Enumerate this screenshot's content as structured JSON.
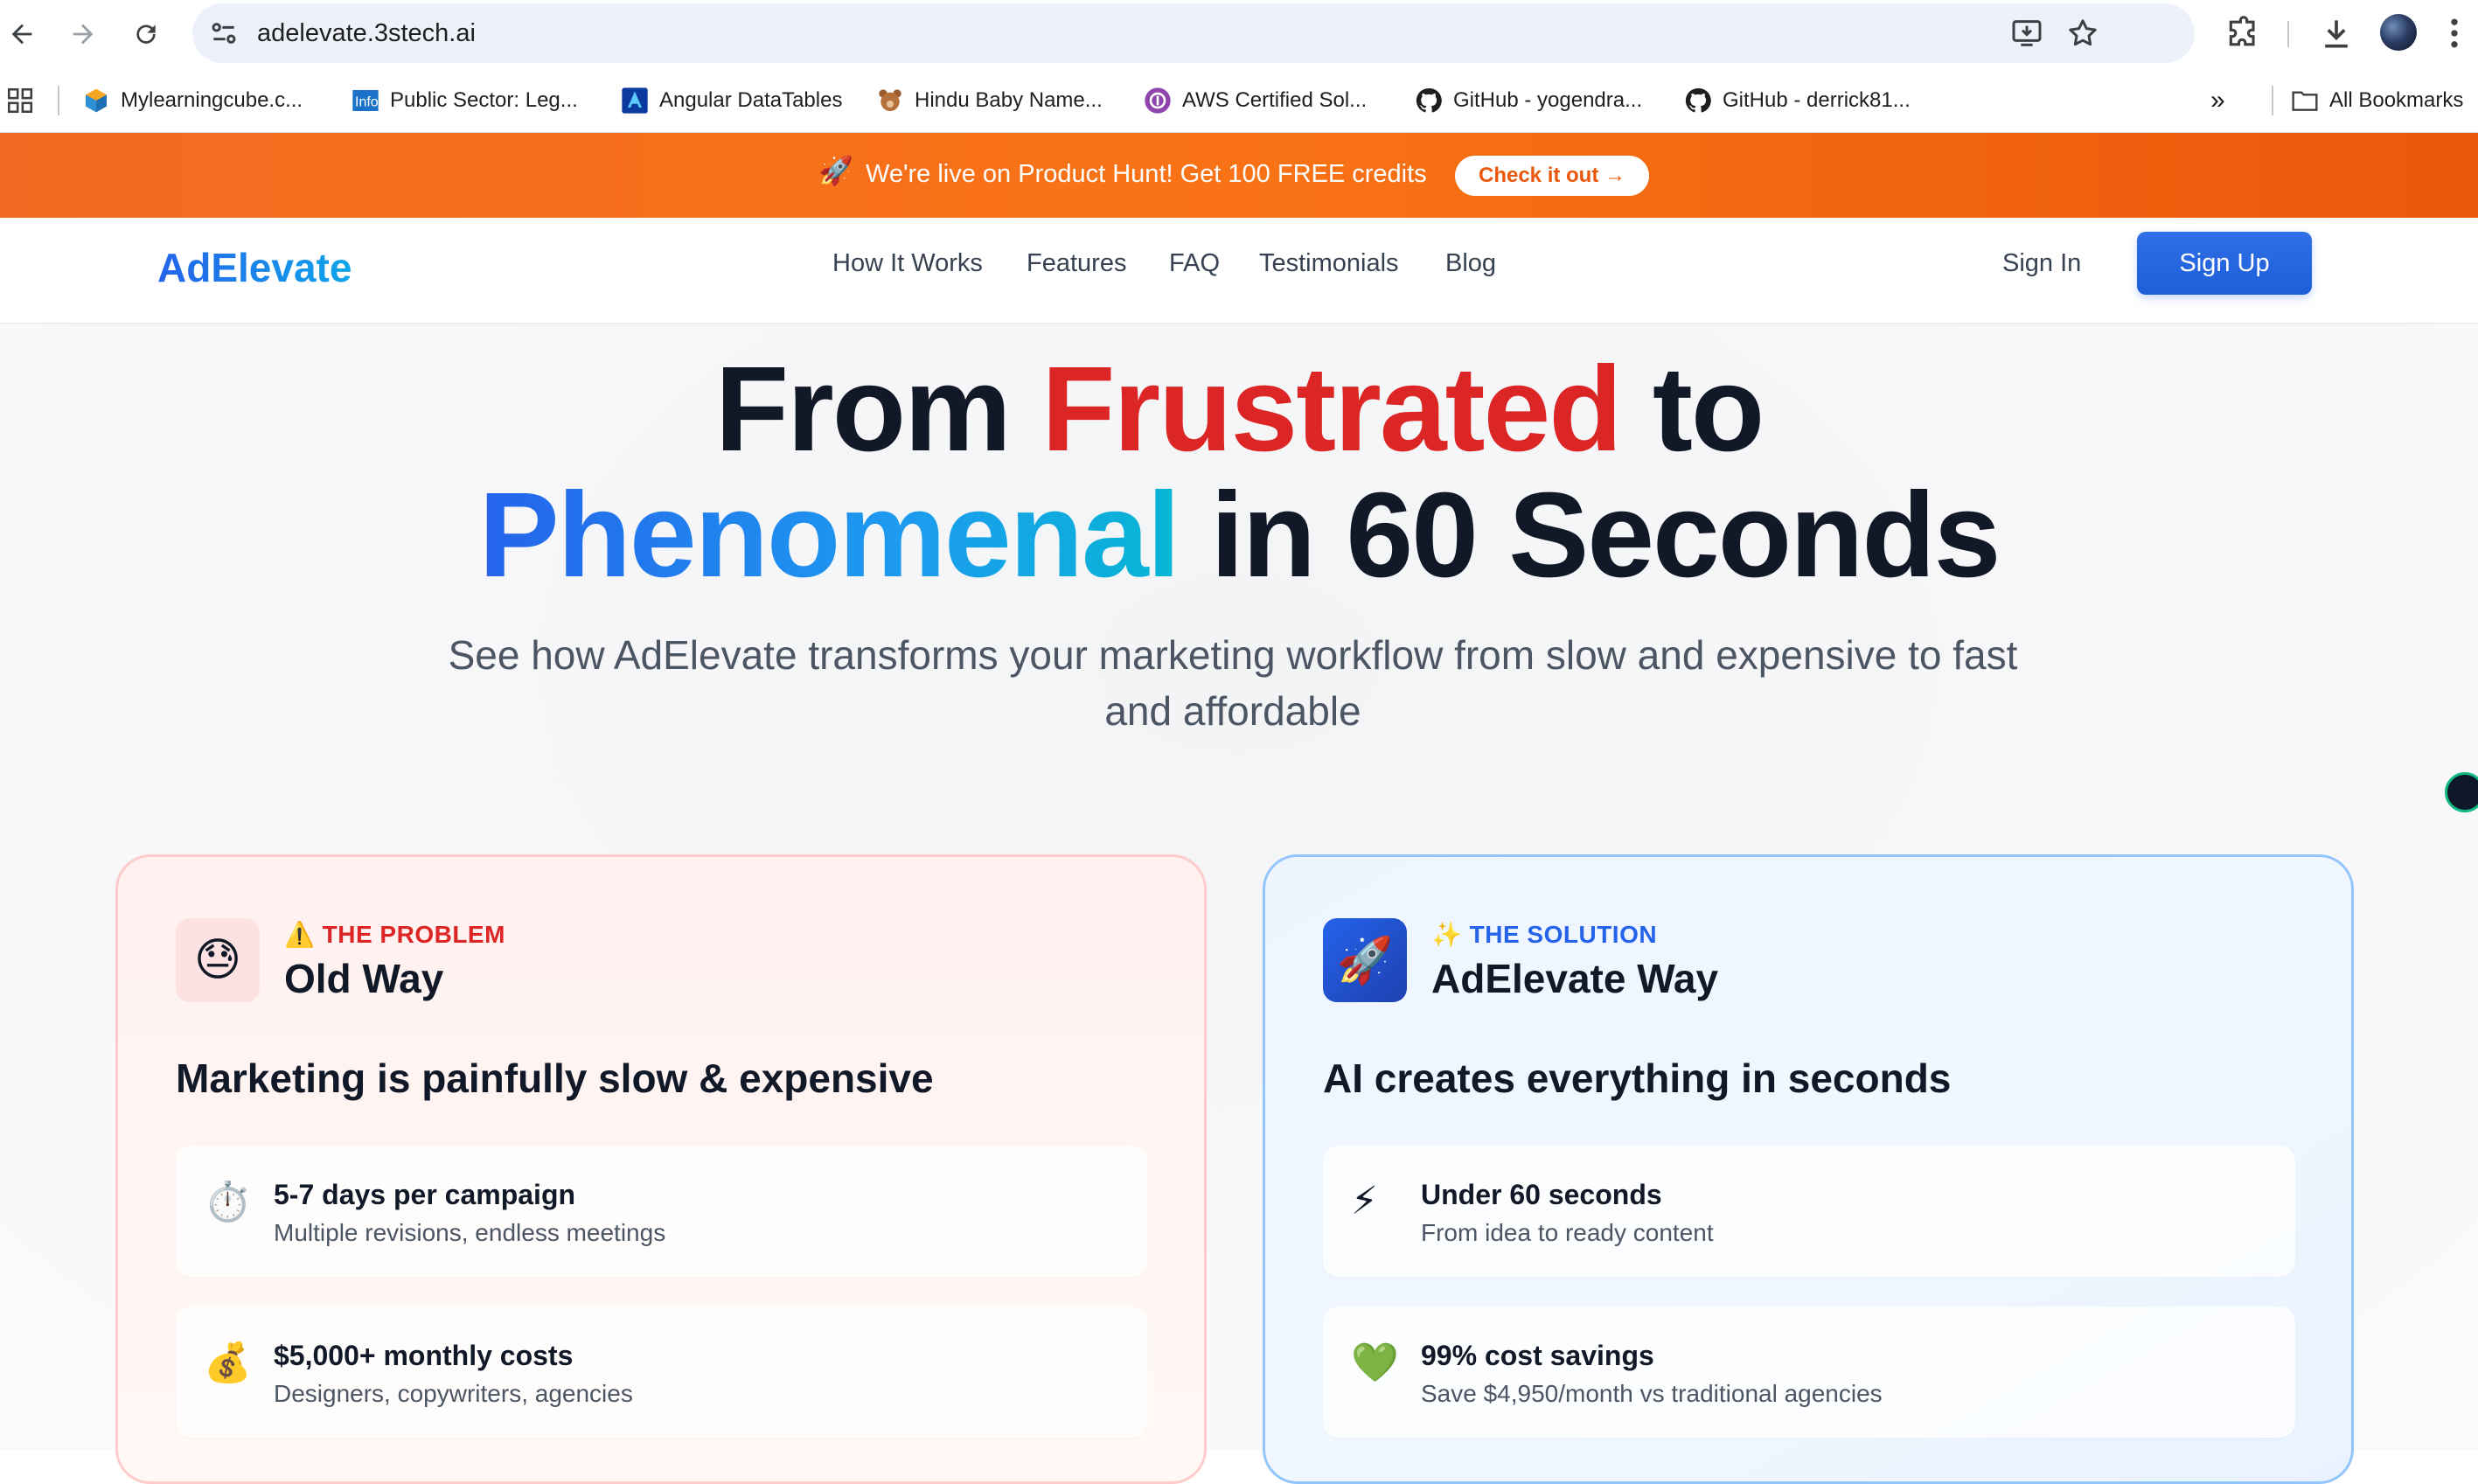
{
  "browser": {
    "url": "adelevate.3stech.ai",
    "bookmarks": [
      {
        "label": "Mylearningcube.c...",
        "icon": "cube-icon"
      },
      {
        "label": "Public Sector: Leg...",
        "icon": "info-icon"
      },
      {
        "label": "Angular DataTables",
        "icon": "angular-icon"
      },
      {
        "label": "Hindu Baby Name...",
        "icon": "teddy-icon"
      },
      {
        "label": "AWS Certified Sol...",
        "icon": "aws-icon"
      },
      {
        "label": "GitHub - yogendra...",
        "icon": "github-icon"
      },
      {
        "label": "GitHub - derrick81...",
        "icon": "github-icon"
      }
    ],
    "more_label": "»",
    "all_bookmarks_label": "All Bookmarks"
  },
  "banner": {
    "emoji": "🚀",
    "text": "We're live on Product Hunt!  Get 100 FREE credits",
    "cta": "Check it out →"
  },
  "nav": {
    "logo": "AdElevate",
    "links": [
      "How It Works",
      "Features",
      "FAQ",
      "Testimonials",
      "Blog"
    ],
    "sign_in": "Sign In",
    "sign_up": "Sign Up"
  },
  "hero": {
    "line1_a": "From ",
    "line1_b": "Frustrated",
    "line1_c": " to",
    "line2_a": "Phenomenal",
    "line2_b": " in 60 Seconds",
    "subtitle": "See how AdElevate transforms your marketing workflow from slow and expensive to fast and affordable"
  },
  "problem": {
    "icon": "😓",
    "tag": "⚠️ THE PROBLEM",
    "title": "Old Way",
    "heading": "Marketing is painfully slow & expensive",
    "items": [
      {
        "emoji": "⏱️",
        "title": "5-7 days per campaign",
        "desc": "Multiple revisions, endless meetings"
      },
      {
        "emoji": "💰",
        "title": "$5,000+ monthly costs",
        "desc": "Designers, copywriters, agencies"
      }
    ]
  },
  "solution": {
    "icon": "🚀",
    "tag": "✨ THE SOLUTION",
    "title": "AdElevate Way",
    "heading": "AI creates everything in seconds",
    "items": [
      {
        "emoji": "⚡",
        "title": "Under 60 seconds",
        "desc": "From idea to ready content"
      },
      {
        "emoji": "💚",
        "title": "99% cost savings",
        "desc": "Save $4,950/month vs traditional agencies"
      }
    ]
  },
  "colors": {
    "banner": "#f97316",
    "primary": "#2563eb",
    "problem_accent": "#dc2626",
    "problem_border": "#fecaca",
    "solution_border": "#93c5fd"
  }
}
